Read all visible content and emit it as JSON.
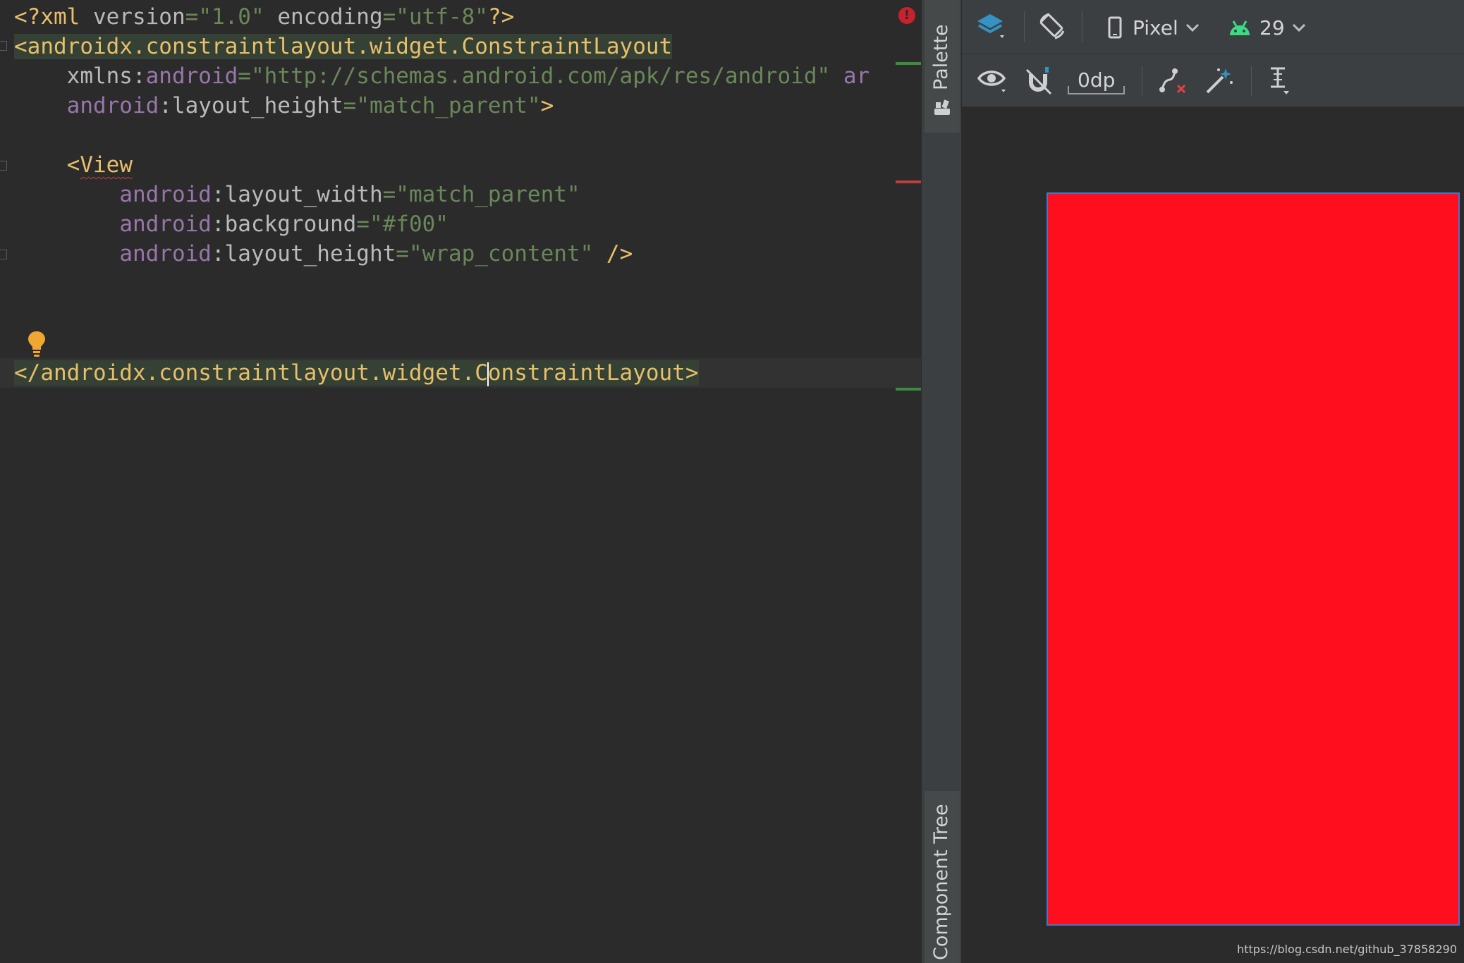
{
  "editor": {
    "lines": {
      "l1": {
        "pi_open": "<?xml ",
        "a1": "version",
        "eq1": "=",
        "v1": "\"1.0\"",
        "sp": " ",
        "a2": "encoding",
        "eq2": "=",
        "v2": "\"utf-8\"",
        "pi_close": "?>"
      },
      "l2": {
        "open": "<",
        "tag_hl": "androidx.constraintlayout.widget.",
        "tag_rest": "ConstraintLayout"
      },
      "l3": {
        "indent": "    ",
        "attr": "xmlns:",
        "ns": "android",
        "eq": "=",
        "val": "\"http://schemas.android.com/apk/res/android\"",
        "sp": " ",
        "cut": "ar"
      },
      "l4": {
        "indent": "    ",
        "ns": "android",
        "colon": ":",
        "attr": "layout_height",
        "eq": "=",
        "val": "\"match_parent\"",
        "close": ">"
      },
      "l6": {
        "indent": "    ",
        "open": "<",
        "tag": "View"
      },
      "l7": {
        "indent": "        ",
        "ns": "android",
        "colon": ":",
        "attr": "layout_width",
        "eq": "=",
        "val": "\"match_parent\""
      },
      "l8": {
        "indent": "        ",
        "ns": "android",
        "colon": ":",
        "attr": "background",
        "eq": "=",
        "val": "\"#f00\""
      },
      "l9": {
        "indent": "        ",
        "ns": "android",
        "colon": ":",
        "attr": "layout_height",
        "eq": "=",
        "val": "\"wrap_content\"",
        "close": " />"
      },
      "l13": {
        "open": "</",
        "tag_a": "androidx.constraintlayout.widget.C",
        "tag_b": "onstraintLayout",
        "close": ">"
      }
    },
    "error_glyph": "!"
  },
  "side_panel": {
    "palette_label": "Palette",
    "component_tree_label": "Component Tree"
  },
  "toolbar_top": {
    "device_label": "Pixel",
    "api_label": "29"
  },
  "toolbar_bottom": {
    "margin_value": "0dp"
  },
  "icons": {
    "design_surface": "layers-icon",
    "orientation": "rotate-icon",
    "device": "phone-icon",
    "api": "android-icon",
    "view_options": "eye-icon",
    "autoconnect": "magnet-off-icon",
    "clear_constraints": "clear-constraints-icon",
    "infer_constraints": "magic-wand-icon",
    "guidelines": "guideline-icon"
  },
  "colors": {
    "preview_fill": "#ff0f1e",
    "android_green": "#3ddc84",
    "layers_blue": "#3592c4"
  },
  "watermark": "https://blog.csdn.net/github_37858290"
}
